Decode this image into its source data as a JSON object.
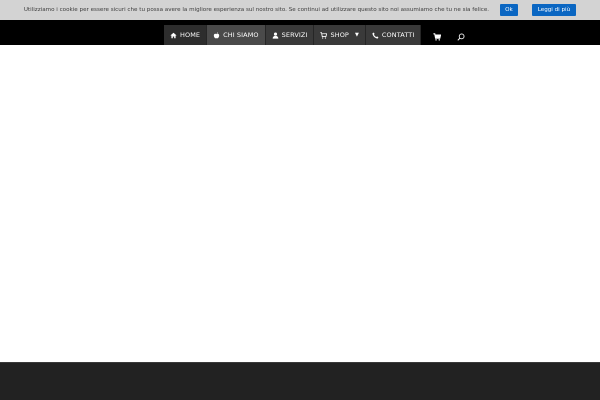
{
  "cookie_bar": {
    "message": "Utilizziamo i cookie per essere sicuri che tu possa avere la migliore esperienza sul nostro sito. Se continui ad utilizzare questo sito noi assumiamo che tu ne sia felice.",
    "ok_label": "Ok",
    "more_label": "Leggi di più",
    "background": "#d3d3d3",
    "button_color": "#0a66c2"
  },
  "nav": {
    "background": "#000000",
    "items": [
      {
        "label": "HOME",
        "icon": "home-icon"
      },
      {
        "label": "CHI SIAMO",
        "icon": "apple-icon"
      },
      {
        "label": "SERVIZI",
        "icon": "user-icon"
      },
      {
        "label": "SHOP",
        "icon": "cart-icon",
        "has_dropdown": true
      },
      {
        "label": "CONTATTI",
        "icon": "phone-icon"
      }
    ],
    "cart_icon": "cart-icon",
    "search_icon": "search-icon",
    "accent": "#2a9fb5"
  },
  "footer": {
    "background": "#222222"
  }
}
